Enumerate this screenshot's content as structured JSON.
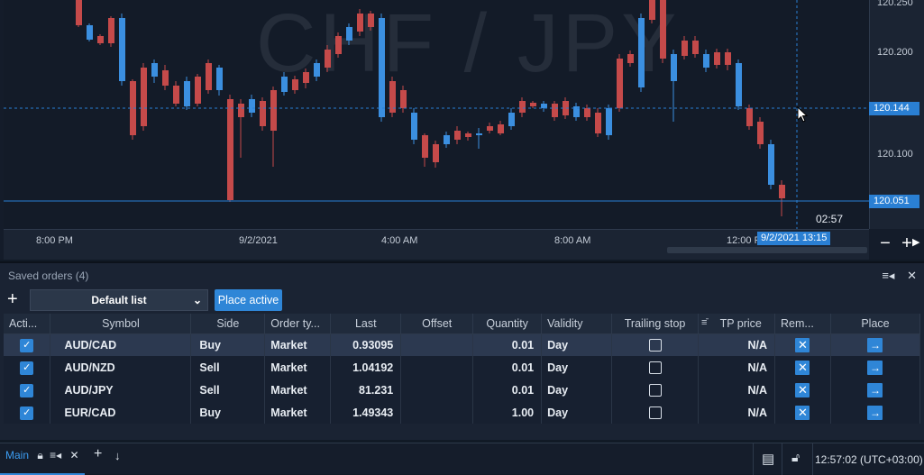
{
  "chart": {
    "symbol": "CHF / JPY",
    "price_ticks": [
      "120.250",
      "120.200",
      "120.100"
    ],
    "price_tags": {
      "current": "120.144",
      "low": "120.051"
    },
    "time_ticks": [
      "8:00 PM",
      "9/2/2021",
      "4:00 AM",
      "8:00 AM",
      "12:00 PM"
    ],
    "crosshair_time": "9/2/2021 13:15",
    "countdown": "02:57",
    "zoom_out": "−",
    "zoom_in": "+",
    "colors": {
      "up": "#3b8fe0",
      "down": "#c54a4a",
      "background": "#131b28",
      "accent": "#2a7fd3"
    }
  },
  "panel": {
    "title": "Saved orders (4)",
    "add_label": "+",
    "list_name": "Default list",
    "place_active_label": "Place active",
    "columns": [
      "Acti...",
      "Symbol",
      "Side",
      "Order ty...",
      "Last",
      "Offset",
      "Quantity",
      "Validity",
      "Trailing stop",
      "TP price",
      "Rem...",
      "Place"
    ],
    "rows": [
      {
        "symbol": "AUD/CAD",
        "side": "Buy",
        "order_type": "Market",
        "last": "0.93095",
        "offset": "",
        "quantity": "0.01",
        "validity": "Day",
        "tp_price": "N/A"
      },
      {
        "symbol": "AUD/NZD",
        "side": "Sell",
        "order_type": "Market",
        "last": "1.04192",
        "offset": "",
        "quantity": "0.01",
        "validity": "Day",
        "tp_price": "N/A"
      },
      {
        "symbol": "AUD/JPY",
        "side": "Sell",
        "order_type": "Market",
        "last": "81.231",
        "offset": "",
        "quantity": "0.01",
        "validity": "Day",
        "tp_price": "N/A"
      },
      {
        "symbol": "EUR/CAD",
        "side": "Buy",
        "order_type": "Market",
        "last": "1.49343",
        "offset": "",
        "quantity": "1.00",
        "validity": "Day",
        "tp_price": "N/A"
      }
    ]
  },
  "statusbar": {
    "tab": "Main",
    "clock": "12:57:02 (UTC+03:00)"
  }
}
